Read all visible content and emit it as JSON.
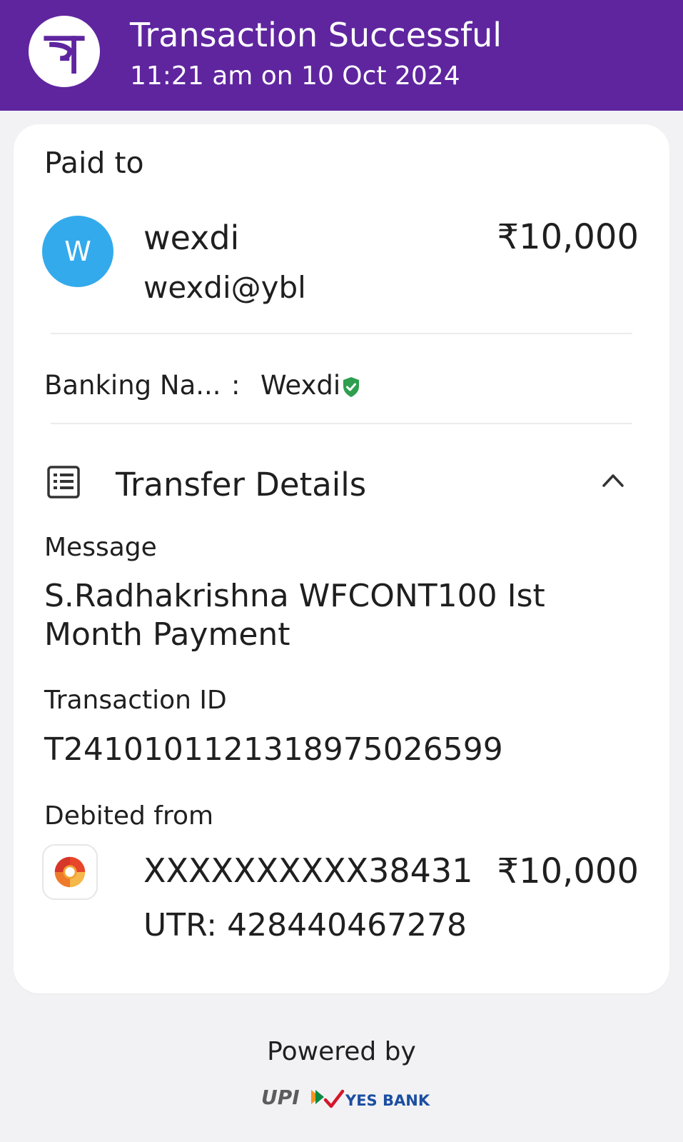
{
  "header": {
    "title": "Transaction Successful",
    "subtitle": "11:21 am on 10 Oct 2024",
    "brand_color": "#5f259f"
  },
  "paid_to": {
    "label": "Paid to",
    "avatar_letter": "W",
    "avatar_color": "#33aaec",
    "name": "wexdi",
    "upi_id": "wexdi@ybl",
    "amount": "₹10,000"
  },
  "banking_name": {
    "label": "Banking Na...",
    "separator": ":",
    "value": "Wexdi",
    "verified_icon": "verified-shield-icon"
  },
  "transfer_details": {
    "title": "Transfer Details",
    "message_label": "Message",
    "message": "S.Radhakrishna WFCONT100 Ist Month Payment",
    "transaction_id_label": "Transaction ID",
    "transaction_id": "T2410101121318975026599",
    "debited_from_label": "Debited from",
    "account": "XXXXXXXXXX38431",
    "amount": "₹10,000",
    "utr": "UTR: 428440467278"
  },
  "footer": {
    "powered_by": "Powered by",
    "upi_logo_text": "UPI",
    "bank_logo_text": "YES BANK"
  }
}
